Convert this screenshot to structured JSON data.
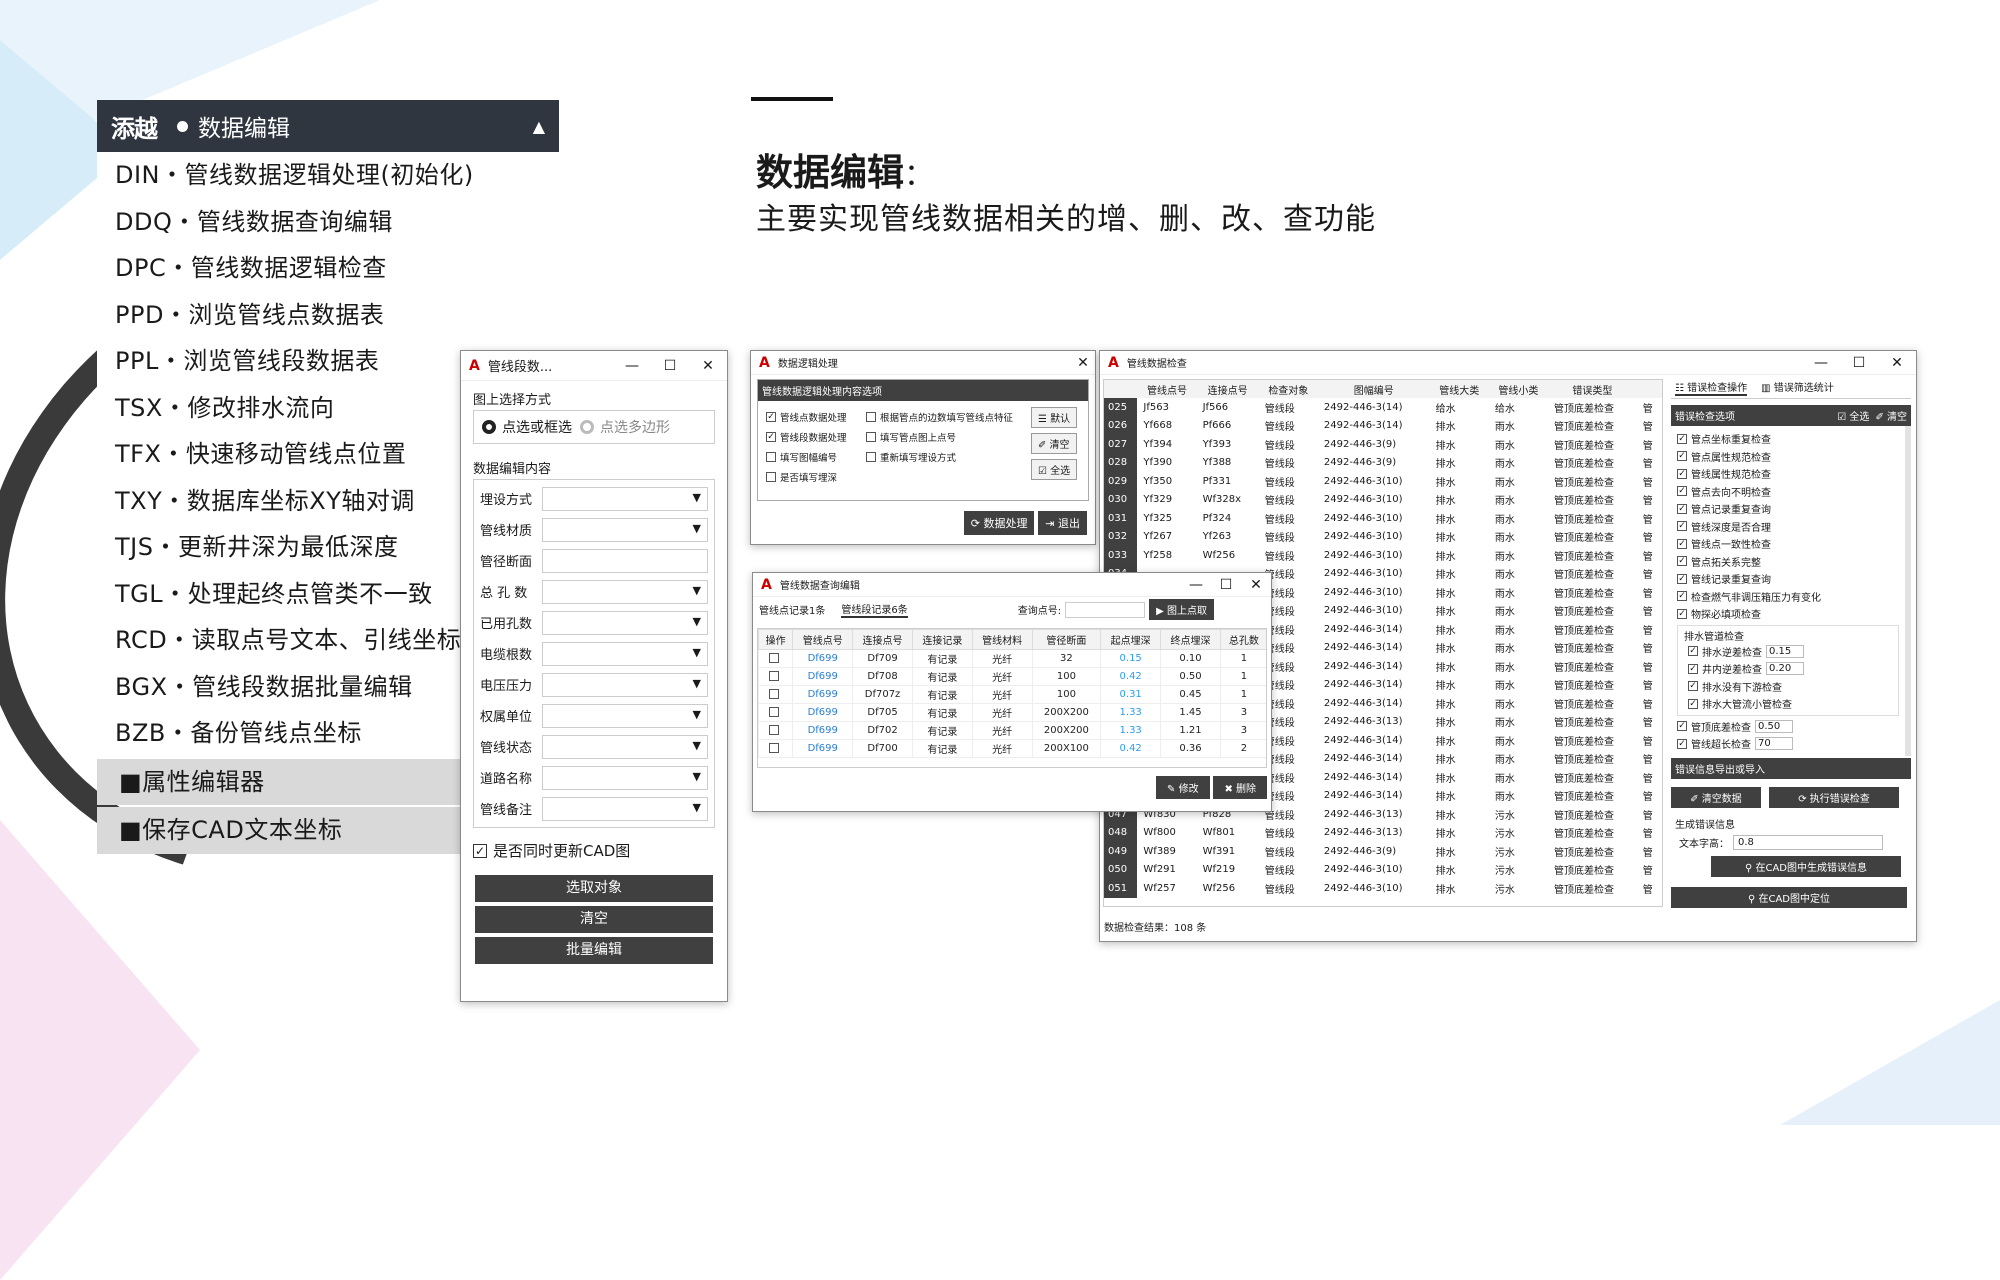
{
  "menu": {
    "logo": "添越",
    "title": "数据编辑",
    "arrow": "▲",
    "items": [
      "DIN・管线数据逻辑处理(初始化)",
      "DDQ・管线数据查询编辑",
      "DPC・管线数据逻辑检查",
      "PPD・浏览管线点数据表",
      "PPL・浏览管线段数据表",
      "TSX・修改排水流向",
      "TFX・快速移动管线点位置",
      "TXY・数据库坐标XY轴对调",
      "TJS・更新井深为最低深度",
      "TGL・处理起终点管类不一致",
      "RCD・读取点号文本、引线坐标",
      "BGX・管线段数据批量编辑",
      "BZB・备份管线点坐标"
    ],
    "grey_items": [
      "■属性编辑器",
      "■保存CAD文本坐标"
    ]
  },
  "heading": {
    "title": "数据编辑",
    "colon": "：",
    "subtitle": "主要实现管线数据相关的增、删、改、查功能"
  },
  "w1": {
    "title": "管线段数...",
    "ctl": [
      "—",
      "☐",
      "✕"
    ],
    "sel_label": "图上选择方式",
    "radio1": "点选或框选",
    "radio2": "点选多边形",
    "content_label": "数据编辑内容",
    "fields": [
      {
        "label": "埋设方式",
        "dd": true
      },
      {
        "label": "管线材质",
        "dd": true
      },
      {
        "label": "管径断面",
        "dd": false
      },
      {
        "label": "总 孔 数",
        "dd": true
      },
      {
        "label": "已用孔数",
        "dd": true
      },
      {
        "label": "电缆根数",
        "dd": true
      },
      {
        "label": "电压压力",
        "dd": true
      },
      {
        "label": "权属单位",
        "dd": true
      },
      {
        "label": "管线状态",
        "dd": true
      },
      {
        "label": "道路名称",
        "dd": true
      },
      {
        "label": "管线备注",
        "dd": true
      }
    ],
    "check": "是否同时更新CAD图",
    "btns": [
      "选取对象",
      "清空",
      "批量编辑"
    ]
  },
  "w2": {
    "title": "数据逻辑处理",
    "group": "管线数据逻辑处理内容选项",
    "col1": [
      {
        "t": "管线点数据处理",
        "c": true
      },
      {
        "t": "管线段数据处理",
        "c": true
      },
      {
        "t": "填写图幅编号",
        "c": false
      },
      {
        "t": "是否填写埋深",
        "c": false
      }
    ],
    "col2": [
      {
        "t": "根据管点的边数填写管线点特征",
        "c": false
      },
      {
        "t": "填写管点图上点号",
        "c": false
      },
      {
        "t": "重新填写埋设方式",
        "c": false
      }
    ],
    "side": [
      "☰ 默认",
      "✐ 清空",
      "☑ 全选"
    ],
    "btns": [
      "⟳ 数据处理",
      "⇥ 退出"
    ]
  },
  "w3": {
    "title": "管线数据查询编辑",
    "tabs": [
      "管线点记录1条",
      "管线段记录6条"
    ],
    "query_label": "查询点号:",
    "pick": "▶ 图上点取",
    "headers": [
      "操作",
      "管线点号",
      "连接点号",
      "连接记录",
      "管线材料",
      "管径断面",
      "起点埋深",
      "终点埋深",
      "总孔数"
    ],
    "rows": [
      [
        "",
        "Df699",
        "Df709",
        "有记录",
        "光纤",
        "32",
        "0.15",
        "0.10",
        "1"
      ],
      [
        "",
        "Df699",
        "Df708",
        "有记录",
        "光纤",
        "100",
        "0.42",
        "0.50",
        "1"
      ],
      [
        "",
        "Df699",
        "Df707z",
        "有记录",
        "光纤",
        "100",
        "0.31",
        "0.45",
        "1"
      ],
      [
        "",
        "Df699",
        "Df705",
        "有记录",
        "光纤",
        "200X200",
        "1.33",
        "1.45",
        "3"
      ],
      [
        "",
        "Df699",
        "Df702",
        "有记录",
        "光纤",
        "200X200",
        "1.33",
        "1.21",
        "3"
      ],
      [
        "",
        "Df699",
        "Df700",
        "有记录",
        "光纤",
        "200X100",
        "0.42",
        "0.36",
        "2"
      ]
    ],
    "btns": [
      "✎ 修改",
      "✖ 删除"
    ]
  },
  "w4": {
    "title": "管线数据检查",
    "headers": [
      "",
      "管线点号",
      "连接点号",
      "检查对象",
      "图幅编号",
      "管线大类",
      "管线小类",
      "错误类型",
      ""
    ],
    "rows": [
      [
        "025",
        "Jf563",
        "Jf566",
        "管线段",
        "2492-446-3(14)",
        "给水",
        "给水",
        "管顶底差检查",
        "管"
      ],
      [
        "026",
        "Yf668",
        "Pf666",
        "管线段",
        "2492-446-3(14)",
        "排水",
        "雨水",
        "管顶底差检查",
        "管"
      ],
      [
        "027",
        "Yf394",
        "Yf393",
        "管线段",
        "2492-446-3(9)",
        "排水",
        "雨水",
        "管顶底差检查",
        "管"
      ],
      [
        "028",
        "Yf390",
        "Yf388",
        "管线段",
        "2492-446-3(9)",
        "排水",
        "雨水",
        "管顶底差检查",
        "管"
      ],
      [
        "029",
        "Yf350",
        "Pf331",
        "管线段",
        "2492-446-3(10)",
        "排水",
        "雨水",
        "管顶底差检查",
        "管"
      ],
      [
        "030",
        "Yf329",
        "Wf328x",
        "管线段",
        "2492-446-3(10)",
        "排水",
        "雨水",
        "管顶底差检查",
        "管"
      ],
      [
        "031",
        "Yf325",
        "Pf324",
        "管线段",
        "2492-446-3(10)",
        "排水",
        "雨水",
        "管顶底差检查",
        "管"
      ],
      [
        "032",
        "Yf267",
        "Yf263",
        "管线段",
        "2492-446-3(10)",
        "排水",
        "雨水",
        "管顶底差检查",
        "管"
      ],
      [
        "033",
        "Yf258",
        "Wf256",
        "管线段",
        "2492-446-3(10)",
        "排水",
        "雨水",
        "管顶底差检查",
        "管"
      ],
      [
        "034",
        "",
        "",
        "管线段",
        "2492-446-3(10)",
        "排水",
        "雨水",
        "管顶底差检查",
        "管"
      ],
      [
        "035",
        "",
        "",
        "管线段",
        "2492-446-3(10)",
        "排水",
        "雨水",
        "管顶底差检查",
        "管"
      ],
      [
        "036",
        "",
        "",
        "管线段",
        "2492-446-3(10)",
        "排水",
        "雨水",
        "管顶底差检查",
        "管"
      ],
      [
        "037",
        "",
        "",
        "管线段",
        "2492-446-3(14)",
        "排水",
        "雨水",
        "管顶底差检查",
        "管"
      ],
      [
        "038",
        "",
        "",
        "管线段",
        "2492-446-3(14)",
        "排水",
        "雨水",
        "管顶底差检查",
        "管"
      ],
      [
        "039",
        "",
        "",
        "管线段",
        "2492-446-3(14)",
        "排水",
        "雨水",
        "管顶底差检查",
        "管"
      ],
      [
        "040",
        "",
        "",
        "管线段",
        "2492-446-3(14)",
        "排水",
        "雨水",
        "管顶底差检查",
        "管"
      ],
      [
        "041",
        "",
        "",
        "管线段",
        "2492-446-3(14)",
        "排水",
        "雨水",
        "管顶底差检查",
        "管"
      ],
      [
        "042",
        "",
        "",
        "管线段",
        "2492-446-3(13)",
        "排水",
        "雨水",
        "管顶底差检查",
        "管"
      ],
      [
        "043",
        "",
        "",
        "管线段",
        "2492-446-3(14)",
        "排水",
        "雨水",
        "管顶底差检查",
        "管"
      ],
      [
        "044",
        "",
        "",
        "管线段",
        "2492-446-3(14)",
        "排水",
        "雨水",
        "管顶底差检查",
        "管"
      ],
      [
        "045",
        "",
        "",
        "管线段",
        "2492-446-3(14)",
        "排水",
        "雨水",
        "管顶底差检查",
        "管"
      ],
      [
        "046",
        "",
        "",
        "管线段",
        "2492-446-3(14)",
        "排水",
        "雨水",
        "管顶底差检查",
        "管"
      ],
      [
        "047",
        "Wf830",
        "Pf828",
        "管线段",
        "2492-446-3(13)",
        "排水",
        "污水",
        "管顶底差检查",
        "管"
      ],
      [
        "048",
        "Wf800",
        "Wf801",
        "管线段",
        "2492-446-3(13)",
        "排水",
        "污水",
        "管顶底差检查",
        "管"
      ],
      [
        "049",
        "Wf389",
        "Wf391",
        "管线段",
        "2492-446-3(9)",
        "排水",
        "污水",
        "管顶底差检查",
        "管"
      ],
      [
        "050",
        "Wf291",
        "Wf219",
        "管线段",
        "2492-446-3(10)",
        "排水",
        "污水",
        "管顶底差检查",
        "管"
      ],
      [
        "051",
        "Wf257",
        "Wf256",
        "管线段",
        "2492-446-3(10)",
        "排水",
        "污水",
        "管顶底差检查",
        "管"
      ]
    ],
    "result": "数据检查结果：108 条",
    "tabs": [
      "☷ 错误检查操作",
      "▥ 错误筛选统计"
    ],
    "panel_title": "错误检查选项",
    "all": "☑ 全选",
    "clear": "✐ 清空",
    "checks": [
      "管点坐标重复检查",
      "管点属性规范检查",
      "管线属性规范检查",
      "管点去向不明检查",
      "管点记录重复查询",
      "管线深度是否合理",
      "管线点一致性检查",
      "管点拓关系完整",
      "管线记录重复查询",
      "检查燃气非调压箱压力有变化",
      "物探必填项检查"
    ],
    "drain_label": "排水管道检查",
    "drain": [
      {
        "t": "排水逆差检查",
        "v": "0.15"
      },
      {
        "t": "井内逆差检查",
        "v": "0.20"
      },
      {
        "t": "排水没有下游检查",
        "v": ""
      },
      {
        "t": "排水大管流小管检查",
        "v": ""
      }
    ],
    "extra": [
      {
        "t": "管顶底差检查",
        "v": "0.50"
      },
      {
        "t": "管线超长检查",
        "v": "70"
      }
    ],
    "export": "错误信息导出或导入",
    "clear_btn": "✐ 清空数据",
    "run_btn": "⟳ 执行错误检查",
    "gen_label": "生成错误信息",
    "font_label": "文本字高：",
    "font_val": "0.8",
    "gen_btn": "⚲ 在CAD图中生成错误信息",
    "locate_btn": "⚲ 在CAD图中定位"
  }
}
